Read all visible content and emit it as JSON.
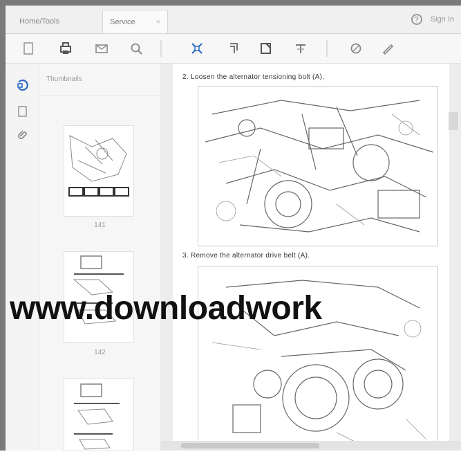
{
  "tabs": [
    {
      "label": "Home/Tools",
      "active": false
    },
    {
      "label": "Service",
      "active": true,
      "close": "×"
    }
  ],
  "header": {
    "help_label": "Sign In"
  },
  "toolbar": {
    "icons": [
      "page-icon",
      "print-icon",
      "mail-icon",
      "search-icon",
      "zoom-fit-icon",
      "rotate-icon",
      "crop-icon",
      "highlight-icon",
      "comment-icon",
      "pen-icon"
    ]
  },
  "rail": {
    "icons": [
      "bookmark-icon",
      "page-thumbnail-icon",
      "attachment-icon"
    ]
  },
  "thumbnails": {
    "header": "Thumbnails",
    "pages": [
      {
        "label": "141"
      },
      {
        "label": "142"
      }
    ]
  },
  "document": {
    "step2": "2. Loosen the alternator tensioning bolt (A).",
    "step3": "3. Remove the alternator drive belt (A)."
  },
  "watermark": {
    "text": "www.downloadwork"
  },
  "colors": {
    "tab_bg": "#f0f0f0",
    "toolbar_bg": "#f7f7f7",
    "doc_bg": "#ededed",
    "accent_icon": "#2a6cc2"
  }
}
